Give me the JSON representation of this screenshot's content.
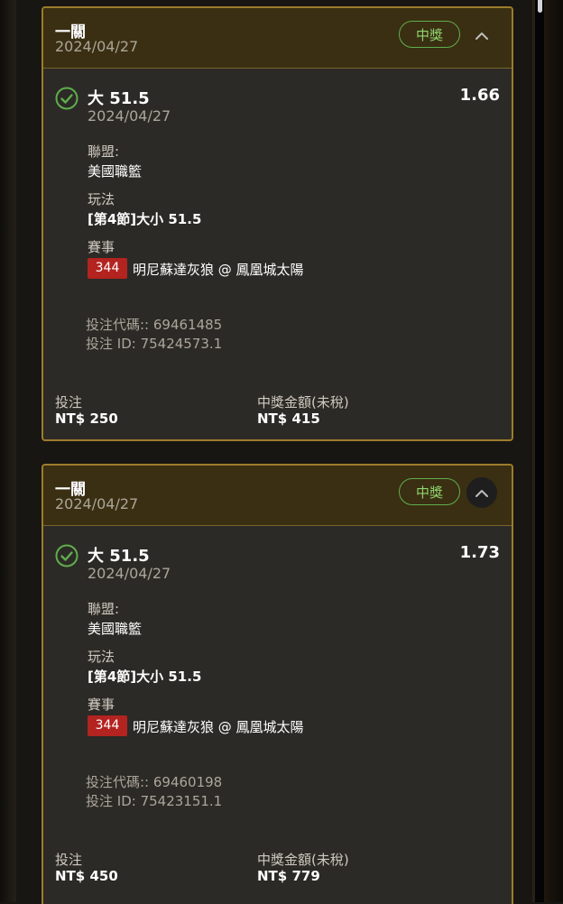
{
  "bets": [
    {
      "parlay_type": "一關",
      "date": "2024/04/27",
      "status": "中獎",
      "selection": "大 51.5",
      "selection_date": "2024/04/27",
      "odds": "1.66",
      "league_label": "聯盟:",
      "league": "美國職籃",
      "market_label": "玩法",
      "market": "[第4節]大小 51.5",
      "event_label": "賽事",
      "event_id": "344",
      "event_name": "明尼蘇達灰狼 @ 鳳凰城太陽",
      "bet_code": "投注代碼:: 69461485",
      "bet_id": "投注 ID: 75424573.1",
      "stake_label": "投注",
      "stake": "NT$ 250",
      "payout_label": "中獎金額(未稅)",
      "payout": "NT$ 415"
    },
    {
      "parlay_type": "一關",
      "date": "2024/04/27",
      "status": "中獎",
      "selection": "大 51.5",
      "selection_date": "2024/04/27",
      "odds": "1.73",
      "league_label": "聯盟:",
      "league": "美國職籃",
      "market_label": "玩法",
      "market": "[第4節]大小 51.5",
      "event_label": "賽事",
      "event_id": "344",
      "event_name": "明尼蘇達灰狼 @ 鳳凰城太陽",
      "bet_code": "投注代碼:: 69460198",
      "bet_id": "投注 ID: 75423151.1",
      "stake_label": "投注",
      "stake": "NT$ 450",
      "payout_label": "中獎金額(未稅)",
      "payout": "NT$ 779"
    }
  ],
  "icons": {
    "toggle": "chevron-up-icon",
    "result": "check-circle-icon"
  },
  "colors": {
    "accent_gold": "#9c7c2c",
    "win_green": "#5fae4d",
    "event_badge": "#b3231f"
  }
}
